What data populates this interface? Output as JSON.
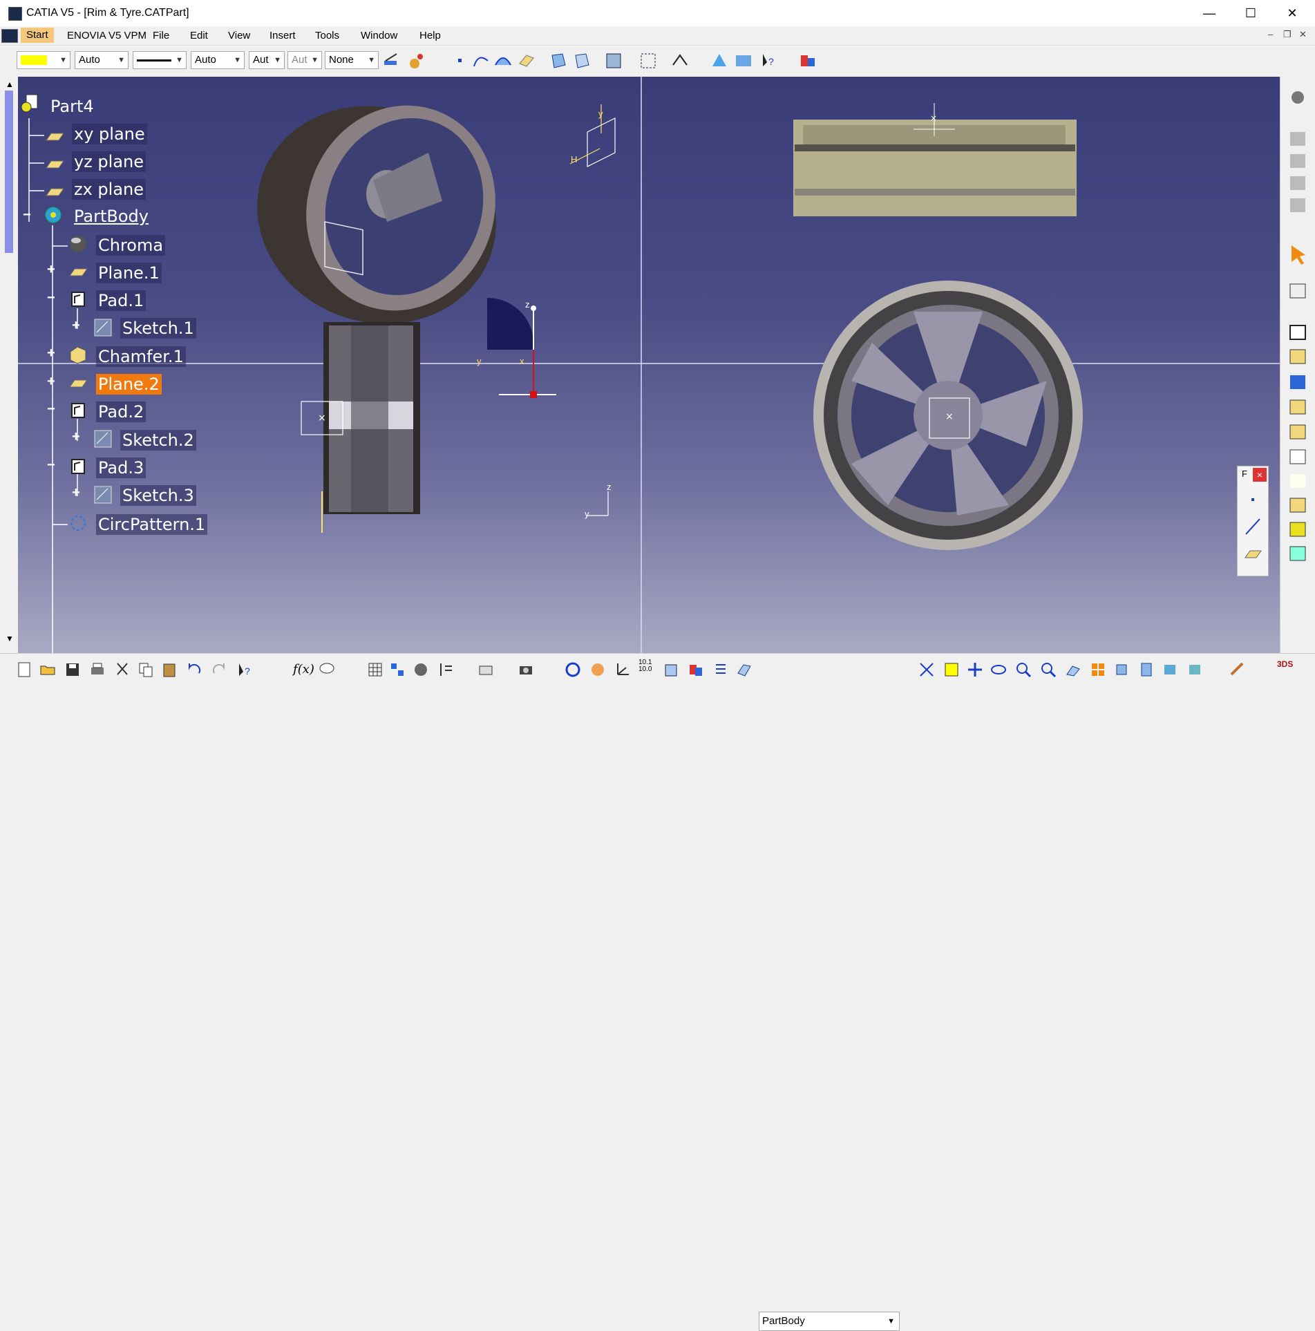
{
  "window": {
    "title": "CATIA V5 - [Rim & Tyre.CATPart]",
    "minimize": "—",
    "maximize": "☐",
    "close": "✕"
  },
  "menu": {
    "start": "Start",
    "items": [
      "ENOVIA V5 VPM",
      "File",
      "Edit",
      "View",
      "Insert",
      "Tools",
      "Window",
      "Help"
    ]
  },
  "toolbar": {
    "color": "#ffff00",
    "linetype_auto": "Auto",
    "thickness_auto": "Auto",
    "pattern1": "Aut",
    "pattern2": "Aut",
    "layer": "None"
  },
  "tree": {
    "root": "Part4",
    "items": [
      {
        "label": "xy plane"
      },
      {
        "label": "yz plane"
      },
      {
        "label": "zx plane"
      },
      {
        "label": "PartBody"
      },
      {
        "label": "Chroma"
      },
      {
        "label": "Plane.1"
      },
      {
        "label": "Pad.1"
      },
      {
        "label": "Sketch.1"
      },
      {
        "label": "Chamfer.1"
      },
      {
        "label": "Plane.2"
      },
      {
        "label": "Pad.2"
      },
      {
        "label": "Sketch.2"
      },
      {
        "label": "Pad.3"
      },
      {
        "label": "Sketch.3"
      },
      {
        "label": "CircPattern.1"
      }
    ]
  },
  "axes": {
    "y": "y",
    "z": "z",
    "x": "x",
    "h": "H"
  },
  "bottom": {
    "current_body": "PartBody",
    "formula": "f(x)"
  },
  "fpanel": {
    "title": "F",
    "close": "×"
  },
  "colors": {
    "selection": "#f07a10",
    "background_top": "#3a3c78",
    "background_bottom": "#a9a9c4"
  }
}
